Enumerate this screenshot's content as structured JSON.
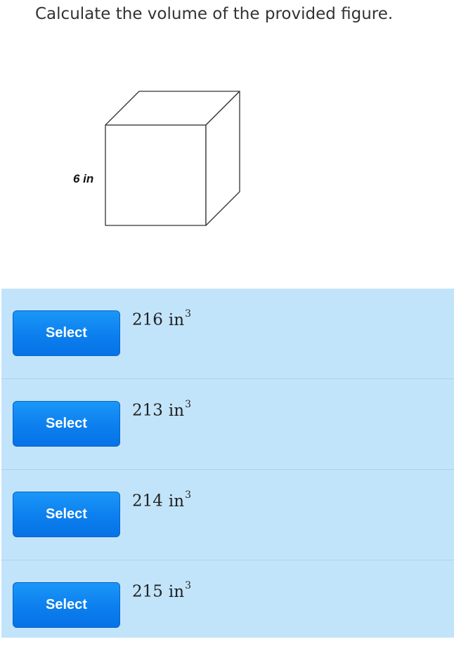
{
  "question": {
    "text": "Calculate the volume of the provided figure."
  },
  "figure": {
    "shape": "cube",
    "side_label": "6 in"
  },
  "answers": [
    {
      "button_label": "Select",
      "value": "216",
      "unit": "in",
      "exponent": "3"
    },
    {
      "button_label": "Select",
      "value": "213",
      "unit": "in",
      "exponent": "3"
    },
    {
      "button_label": "Select",
      "value": "214",
      "unit": "in",
      "exponent": "3"
    },
    {
      "button_label": "Select",
      "value": "215",
      "unit": "in",
      "exponent": "3"
    }
  ],
  "colors": {
    "answer_panel_bg": "#c2e4fa",
    "button_blue": "#0c7fee",
    "button_text": "#ffffff"
  }
}
